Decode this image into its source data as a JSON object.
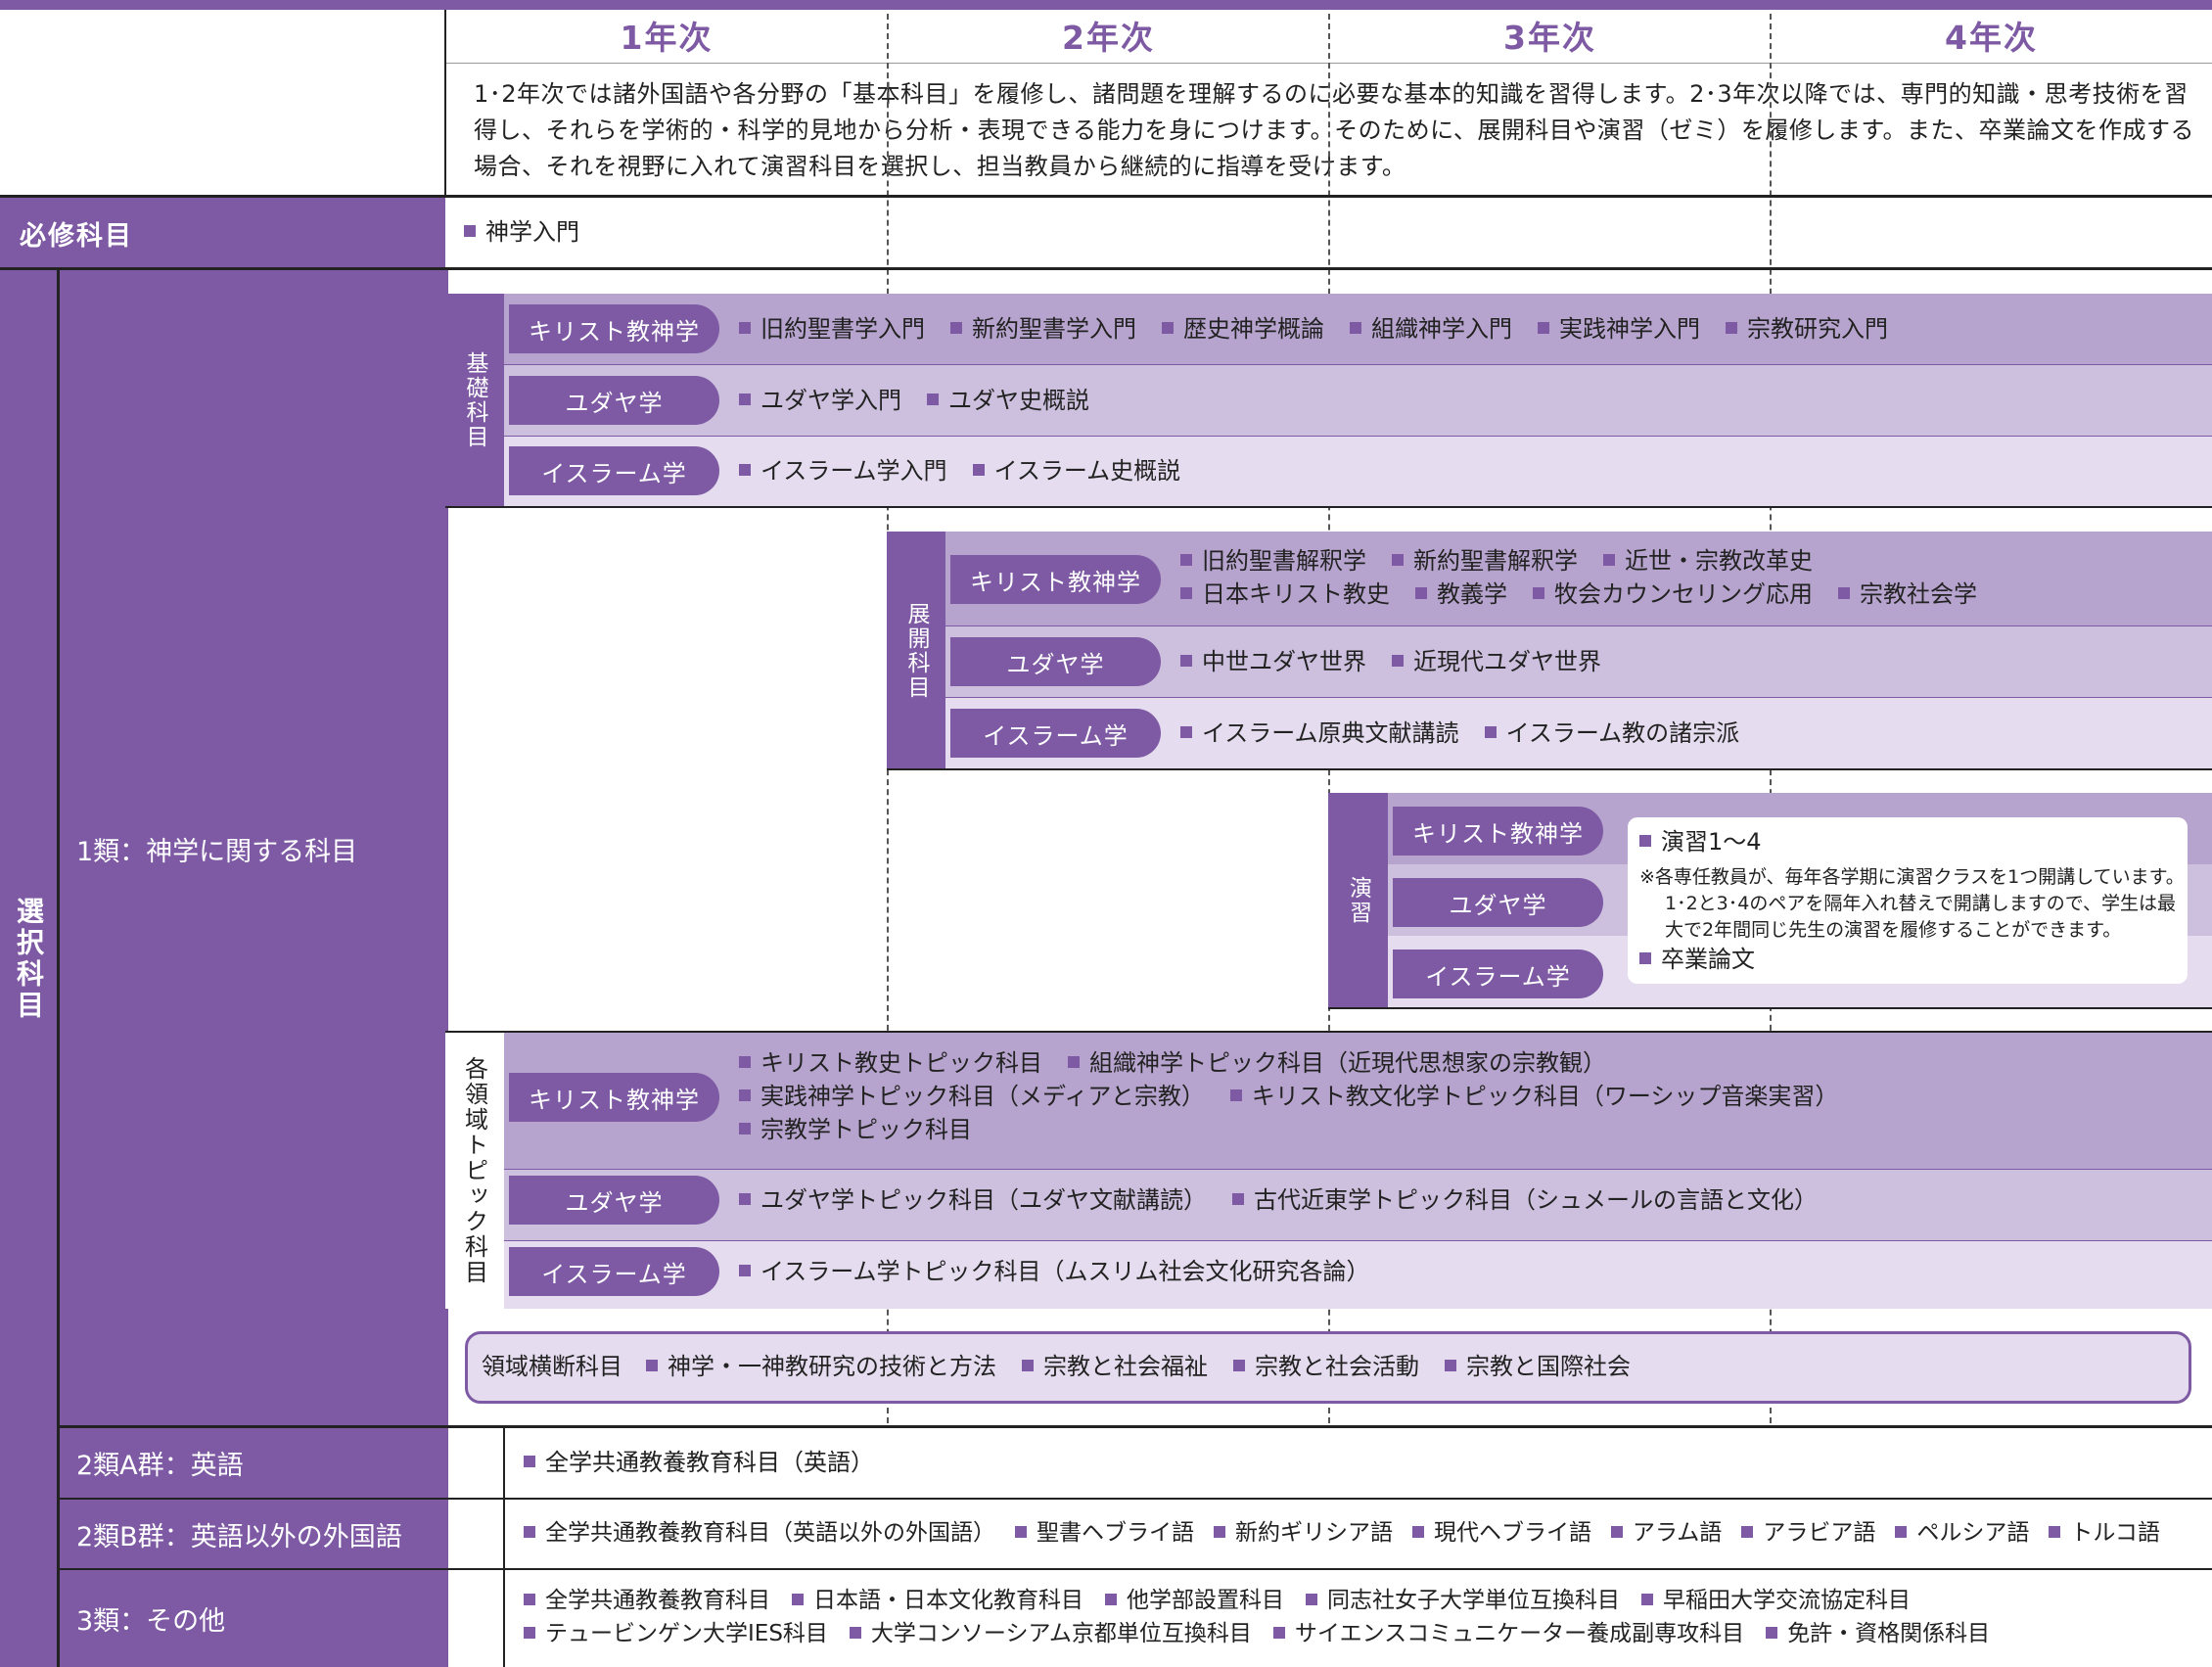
{
  "header": {
    "years": [
      "1年次",
      "2年次",
      "3年次",
      "4年次"
    ],
    "intro": "1･2年次では諸外国語や各分野の「基本科目」を履修し、諸問題を理解するのに必要な基本的知識を習得します。2･3年次以降では、専門的知識・思考技術を習得し、それらを学術的・科学的見地から分析・表現できる能力を身につけます。そのために、展開科目や演習（ゼミ）を履修します。また、卒業論文を作成する場合、それを視野に入れて演習科目を選択し、担当教員から継続的に指導を受けます。"
  },
  "required": {
    "label": "必修科目",
    "items": [
      "神学入門"
    ]
  },
  "elective": {
    "label": "選択科目",
    "class1_label": "1類：神学に関する科目",
    "basic": {
      "label": "基礎科目",
      "rows": [
        {
          "pill": "キリスト教神学",
          "items": [
            "旧約聖書学入門",
            "新約聖書学入門",
            "歴史神学概論",
            "組織神学入門",
            "実践神学入門",
            "宗教研究入門"
          ]
        },
        {
          "pill": "ユダヤ学",
          "items": [
            "ユダヤ学入門",
            "ユダヤ史概説"
          ]
        },
        {
          "pill": "イスラーム学",
          "items": [
            "イスラーム学入門",
            "イスラーム史概説"
          ]
        }
      ]
    },
    "advanced": {
      "label": "展開科目",
      "rows": [
        {
          "pill": "キリスト教神学",
          "lines": [
            [
              "旧約聖書解釈学",
              "新約聖書解釈学",
              "近世・宗教改革史"
            ],
            [
              "日本キリスト教史",
              "教義学",
              "牧会カウンセリング応用",
              "宗教社会学"
            ]
          ]
        },
        {
          "pill": "ユダヤ学",
          "lines": [
            [
              "中世ユダヤ世界",
              "近現代ユダヤ世界"
            ]
          ]
        },
        {
          "pill": "イスラーム学",
          "lines": [
            [
              "イスラーム原典文献講読",
              "イスラーム教の諸宗派"
            ]
          ]
        }
      ]
    },
    "seminar": {
      "label": "演習",
      "pills": [
        "キリスト教神学",
        "ユダヤ学",
        "イスラーム学"
      ],
      "item1": "演習1〜4",
      "note": [
        "※各専任教員が、毎年各学期に演習クラスを1つ開講しています。",
        "1･2と3･4のペアを隔年入れ替えで開講しますので、学生は最",
        "大で2年間同じ先生の演習を履修することができます。"
      ],
      "item2": "卒業論文"
    },
    "topic": {
      "label": "各領域トピック科目",
      "rows": [
        {
          "pill": "キリスト教神学",
          "lines": [
            [
              "キリスト教史トピック科目",
              "組織神学トピック科目（近現代思想家の宗教観）"
            ],
            [
              "実践神学トピック科目（メディアと宗教）",
              "キリスト教文化学トピック科目（ワーシップ音楽実習）"
            ],
            [
              "宗教学トピック科目"
            ]
          ]
        },
        {
          "pill": "ユダヤ学",
          "lines": [
            [
              "ユダヤ学トピック科目（ユダヤ文献講読）",
              "古代近東学トピック科目（シュメールの言語と文化）"
            ]
          ]
        },
        {
          "pill": "イスラーム学",
          "lines": [
            [
              "イスラーム学トピック科目（ムスリム社会文化研究各論）"
            ]
          ]
        }
      ]
    },
    "cross": {
      "label": "領域横断科目",
      "items": [
        "神学・一神教研究の技術と方法",
        "宗教と社会福祉",
        "宗教と社会活動",
        "宗教と国際社会"
      ]
    },
    "class2a": {
      "label": "2類A群：英語",
      "items": [
        "全学共通教養教育科目（英語）"
      ]
    },
    "class2b": {
      "label": "2類B群：英語以外の外国語",
      "items": [
        "全学共通教養教育科目（英語以外の外国語）",
        "聖書ヘブライ語",
        "新約ギリシア語",
        "現代ヘブライ語",
        "アラム語",
        "アラビア語",
        "ペルシア語",
        "トルコ語"
      ]
    },
    "class3": {
      "label": "3類：その他",
      "lines": [
        [
          "全学共通教養教育科目",
          "日本語・日本文化教育科目",
          "他学部設置科目",
          "同志社女子大学単位互換科目",
          "早稲田大学交流協定科目"
        ],
        [
          "テュービンゲン大学IES科目",
          "大学コンソーシアム京都単位互換科目",
          "サイエンスコミュニケーター養成副専攻科目",
          "免許・資格関係科目"
        ]
      ]
    }
  },
  "colors": {
    "accent": "#7d5aa3",
    "band1": "#b7a4ce",
    "band2": "#cdc0de",
    "band3": "#e5ddef"
  }
}
